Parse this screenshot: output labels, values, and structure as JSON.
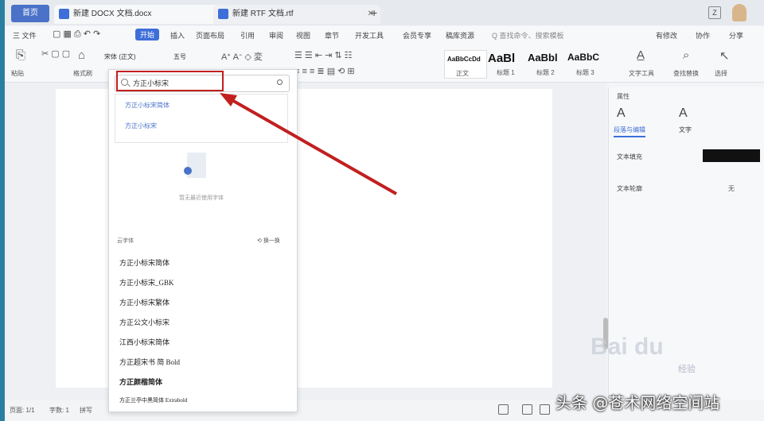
{
  "tabs": {
    "home_label": "首页",
    "doc1_label": "新建 DOCX 文档.docx",
    "doc2_label": "新建 RTF 文档.rtf",
    "new_tab": "+"
  },
  "menu": {
    "file": "三 文件",
    "items": [
      "开始",
      "插入",
      "页面布局",
      "引用",
      "审阅",
      "视图",
      "章节",
      "开发工具",
      "会员专享",
      "稿库资源"
    ],
    "active": "开始",
    "search_hint": "Q 查找命令、搜索模板",
    "right": [
      "有修改",
      "协作",
      "分享"
    ]
  },
  "ribbon": {
    "paste": "格式刷",
    "brush": "粘贴",
    "font_name": "宋体 (正文)",
    "font_size": "五号",
    "styles": [
      {
        "big": "AaBbCcDd",
        "label": "正文"
      },
      {
        "big": "AaBl",
        "label": "标题 1"
      },
      {
        "big": "AaBbl",
        "label": "标题 2"
      },
      {
        "big": "AaBbC",
        "label": "标题 3"
      }
    ],
    "text_tools": "文字工具",
    "find_replace": "查找替换",
    "select": "选择"
  },
  "font_panel": {
    "search_value": "方正小标宋",
    "suggestions": [
      "方正小标宋简体",
      "方正小标宋"
    ],
    "empty_text": "暂无最近使用字体",
    "section_label": "云字体",
    "swap_label": "换一换",
    "fonts": [
      "方正小标宋简体",
      "方正小标宋_GBK",
      "方正小标宋繁体",
      "方正公文小标宋",
      "江西小标宋简体",
      "方正超宋书 简 Bold",
      "方正颜楷简体",
      "方正兰亭中黑简体 Extrabold"
    ]
  },
  "right_pane": {
    "title": "属性",
    "tab1": "段落与编辑",
    "tab2": "文字",
    "row1": "文本填充",
    "row2": "文本轮廓",
    "row2_value": "无"
  },
  "status": {
    "page": "页面: 1/1",
    "words": "字数: 1",
    "spell": "拼写"
  },
  "watermarks": {
    "baidu": "Bai du",
    "jingyan": "经验",
    "toutiao": "头条 @苍术网络空间站"
  },
  "colors": {
    "accent": "#3e6fd8",
    "highlight_red": "#c21f1f"
  }
}
